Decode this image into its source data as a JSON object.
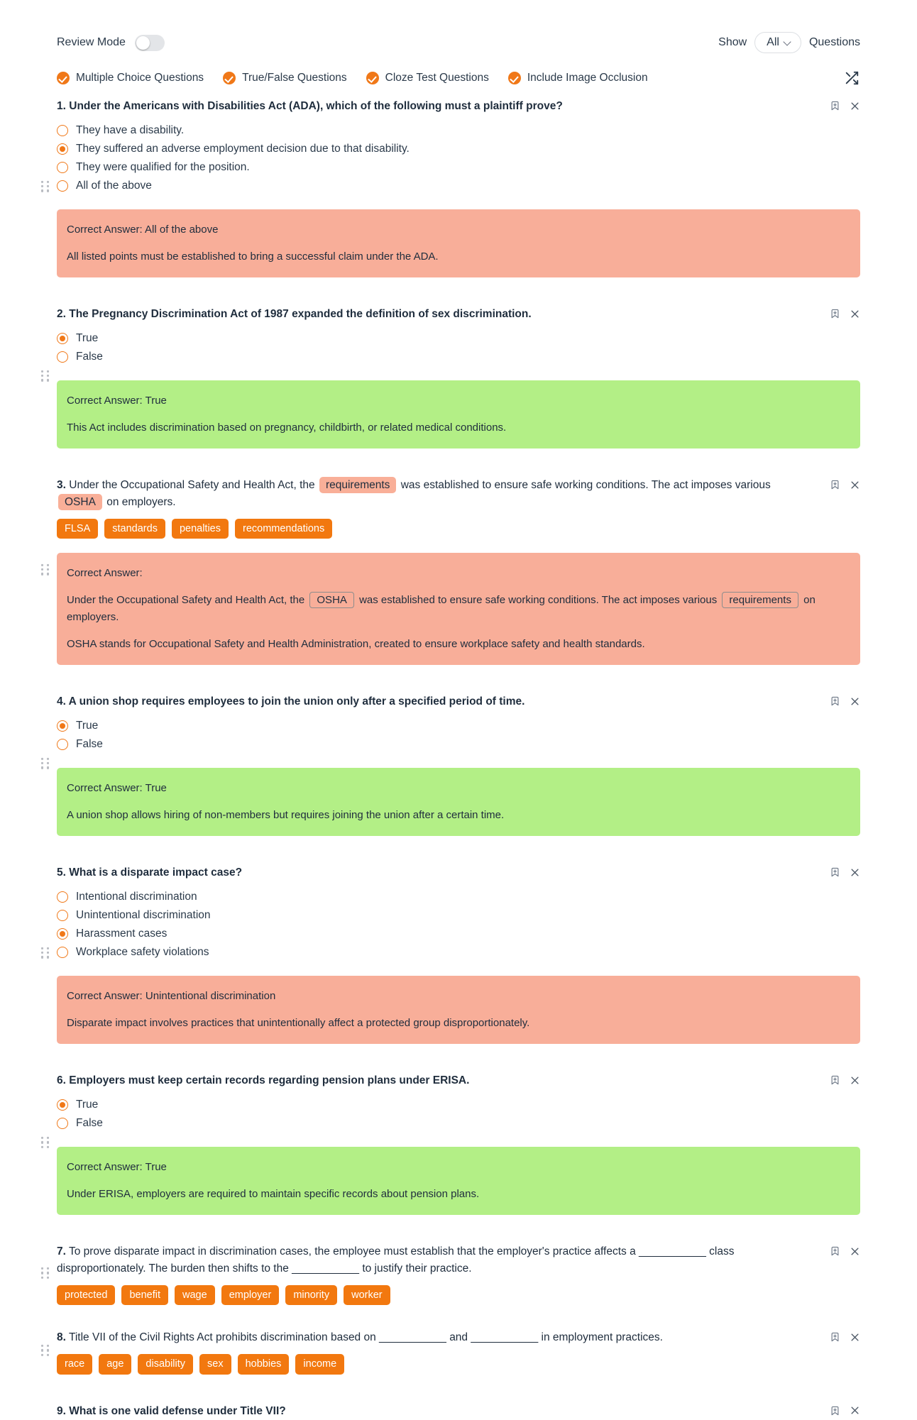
{
  "topbar": {
    "review_mode_label": "Review Mode",
    "review_mode_on": false,
    "show_label": "Show",
    "show_value": "All",
    "questions_label": "Questions",
    "shuffle_icon": "shuffle-icon"
  },
  "filters": [
    {
      "label": "Multiple Choice Questions",
      "checked": true
    },
    {
      "label": "True/False Questions",
      "checked": true
    },
    {
      "label": "Cloze Test Questions",
      "checked": true
    },
    {
      "label": "Include Image Occlusion",
      "checked": true
    }
  ],
  "colors": {
    "accent_orange": "#f07818",
    "chip_orange": "#f2780f",
    "wrong_box": "#f8ae99",
    "right_box": "#b3ef86",
    "blank_fill": "#f9af98",
    "text": "#1f2d3d"
  },
  "questions": [
    {
      "num": "1.",
      "type": "mcq",
      "text": "Under the Americans with Disabilities Act (ADA), which of the following must a plaintiff prove?",
      "options": [
        {
          "label": "They have a disability.",
          "selected": false
        },
        {
          "label": "They suffered an adverse employment decision due to that disability.",
          "selected": true
        },
        {
          "label": "They were qualified for the position.",
          "selected": false
        },
        {
          "label": "All of the above",
          "selected": false
        }
      ],
      "answer": {
        "status": "wrong",
        "heading": "Correct Answer: All of the above",
        "explanation": "All listed points must be established to bring a successful claim under the ADA."
      }
    },
    {
      "num": "2.",
      "type": "truefalse",
      "text": "The Pregnancy Discrimination Act of 1987 expanded the definition of sex discrimination.",
      "options": [
        {
          "label": "True",
          "selected": true
        },
        {
          "label": "False",
          "selected": false
        }
      ],
      "answer": {
        "status": "right",
        "heading": "Correct Answer: True",
        "explanation": "This Act includes discrimination based on pregnancy, childbirth, or related medical conditions."
      }
    },
    {
      "num": "3.",
      "type": "cloze",
      "seg1": "Under the Occupational Safety and Health Act, the",
      "fill1": "requirements",
      "seg2": "was established to ensure safe working conditions. The act imposes various",
      "fill2": "OSHA",
      "seg3": "on employers.",
      "chips": [
        "FLSA",
        "standards",
        "penalties",
        "recommendations"
      ],
      "answer": {
        "status": "wrong",
        "heading": "Correct Answer:",
        "a_seg1": "Under the Occupational Safety and Health Act, the",
        "a_fill1": "OSHA",
        "a_seg2": "was established to ensure safe working conditions. The act imposes various",
        "a_fill2": "requirements",
        "a_seg3": "on employers.",
        "explanation": "OSHA stands for Occupational Safety and Health Administration, created to ensure workplace safety and health standards."
      }
    },
    {
      "num": "4.",
      "type": "truefalse",
      "text": "A union shop requires employees to join the union only after a specified period of time.",
      "options": [
        {
          "label": "True",
          "selected": true
        },
        {
          "label": "False",
          "selected": false
        }
      ],
      "answer": {
        "status": "right",
        "heading": "Correct Answer: True",
        "explanation": "A union shop allows hiring of non-members but requires joining the union after a certain time."
      }
    },
    {
      "num": "5.",
      "type": "mcq",
      "text": "What is a disparate impact case?",
      "options": [
        {
          "label": "Intentional discrimination",
          "selected": false
        },
        {
          "label": "Unintentional discrimination",
          "selected": false
        },
        {
          "label": "Harassment cases",
          "selected": true
        },
        {
          "label": "Workplace safety violations",
          "selected": false
        }
      ],
      "answer": {
        "status": "wrong",
        "heading": "Correct Answer: Unintentional discrimination",
        "explanation": "Disparate impact involves practices that unintentionally affect a protected group disproportionately."
      }
    },
    {
      "num": "6.",
      "type": "truefalse",
      "text": "Employers must keep certain records regarding pension plans under ERISA.",
      "options": [
        {
          "label": "True",
          "selected": true
        },
        {
          "label": "False",
          "selected": false
        }
      ],
      "answer": {
        "status": "right",
        "heading": "Correct Answer: True",
        "explanation": "Under ERISA, employers are required to maintain specific records about pension plans."
      }
    },
    {
      "num": "7.",
      "type": "cloze-blank",
      "seg1": "To prove disparate impact in discrimination cases, the employee must establish that the employer's practice affects a",
      "blank1": "___________",
      "seg2": "class disproportionately. The burden then shifts to the",
      "blank2": "___________",
      "seg3": "to justify their practice.",
      "chips": [
        "protected",
        "benefit",
        "wage",
        "employer",
        "minority",
        "worker"
      ]
    },
    {
      "num": "8.",
      "type": "cloze-blank",
      "seg1": "Title VII of the Civil Rights Act prohibits discrimination based on",
      "blank1": "___________",
      "seg2": "and",
      "blank2": "___________",
      "seg3": "in employment practices.",
      "chips": [
        "race",
        "age",
        "disability",
        "sex",
        "hobbies",
        "income"
      ]
    },
    {
      "num": "9.",
      "type": "mcq",
      "text": "What is one valid defense under Title VII?",
      "options": []
    }
  ]
}
